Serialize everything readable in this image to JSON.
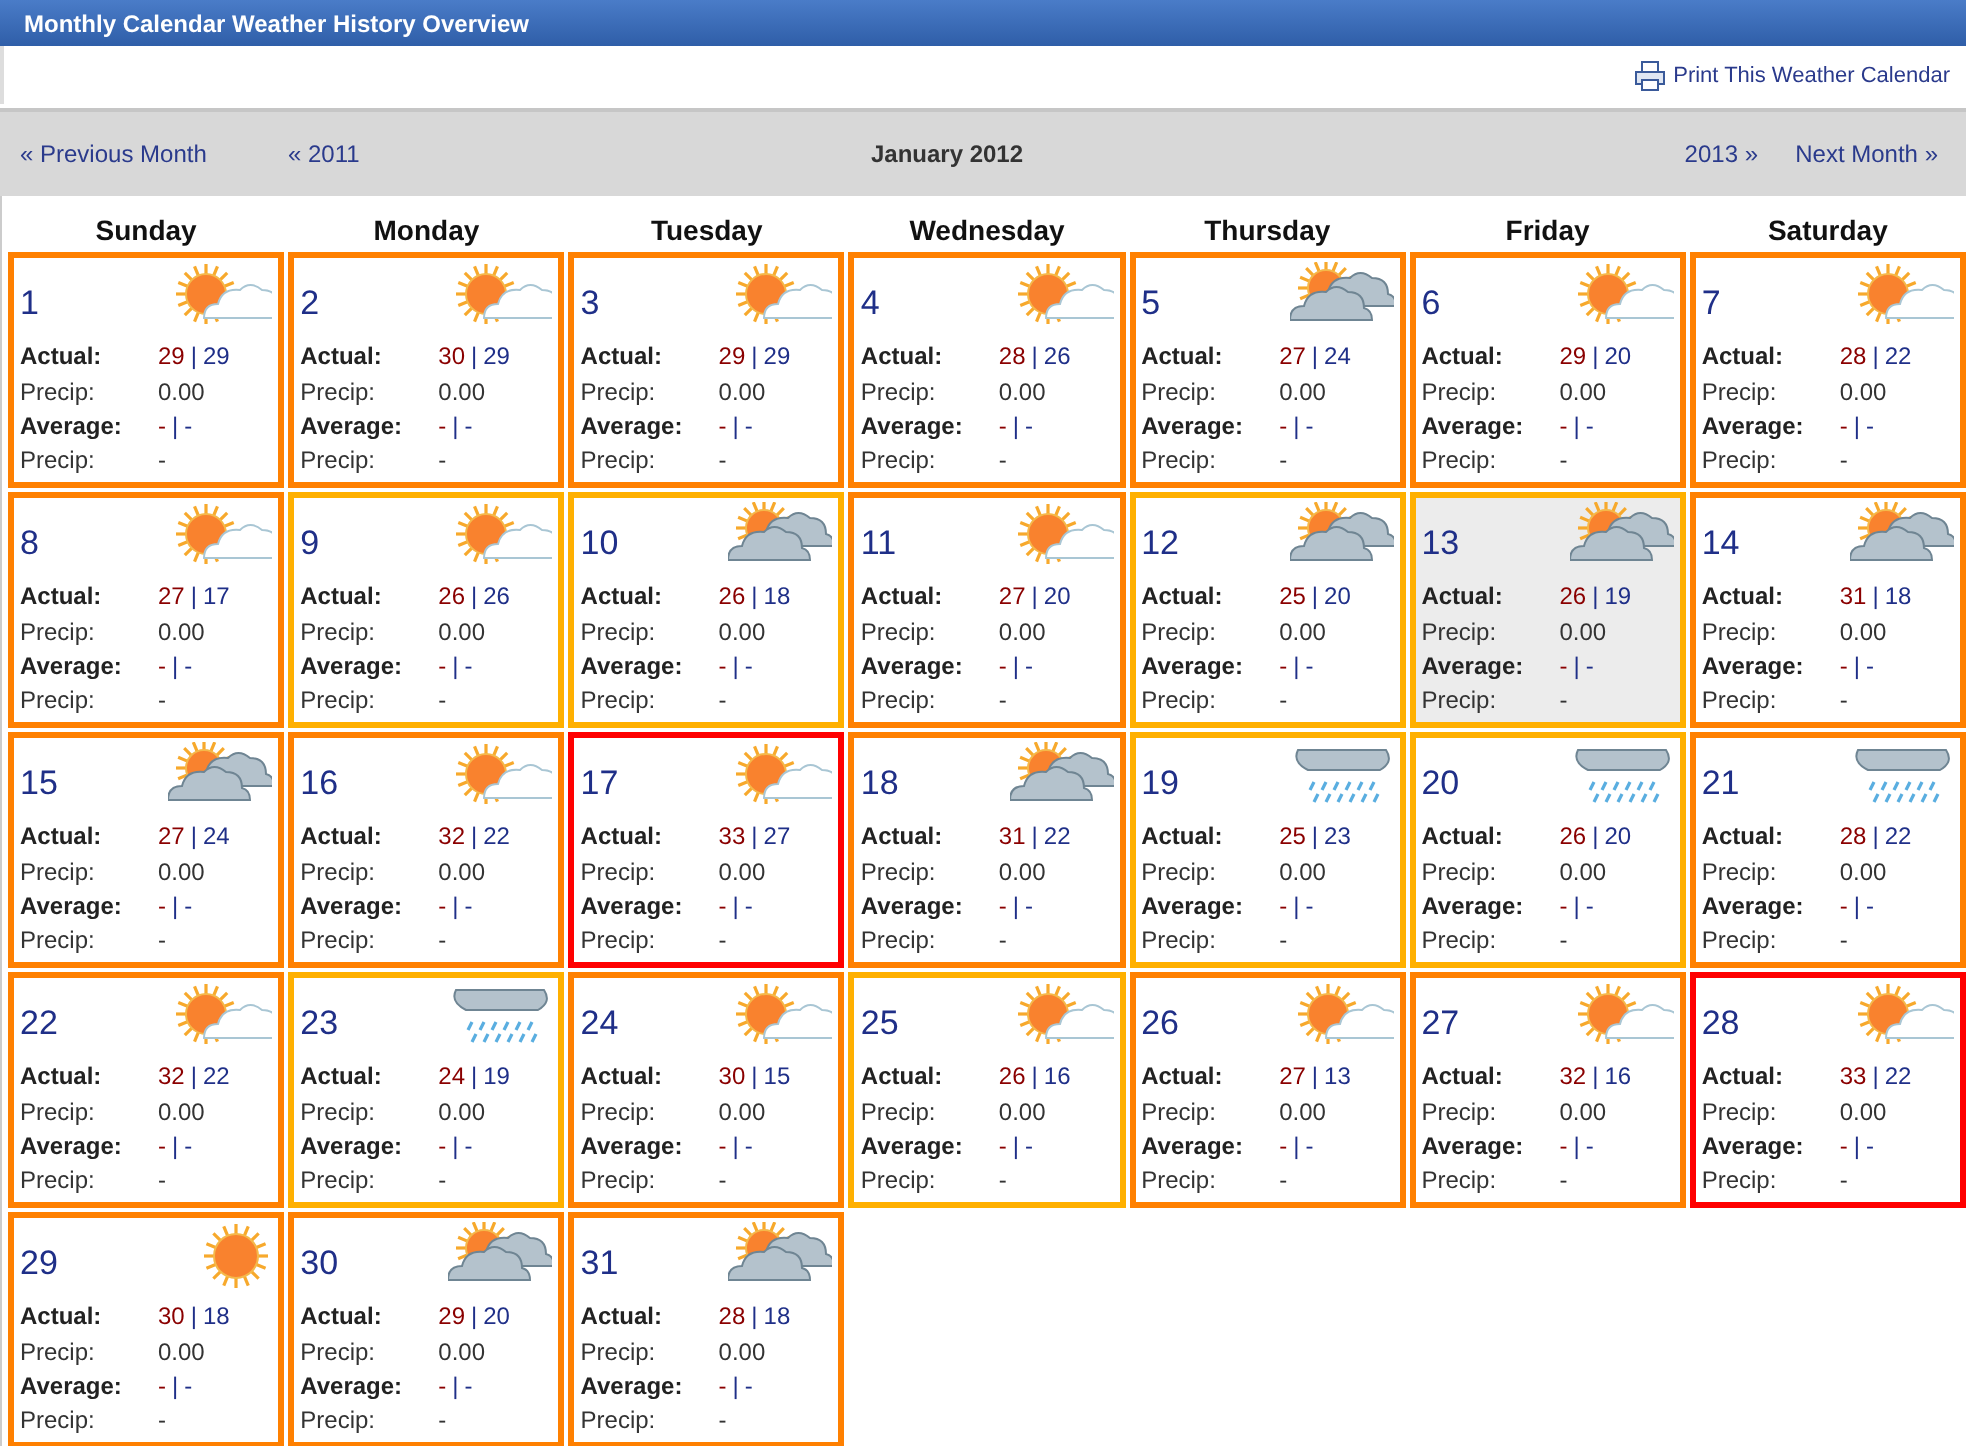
{
  "window": {
    "title": "Monthly Calendar Weather History Overview"
  },
  "print_link": "Print This Weather Calendar",
  "nav": {
    "prev_month": "« Previous Month",
    "prev_year": "« 2011",
    "current": "January 2012",
    "next_year": "2013 »",
    "next_month": "Next Month »"
  },
  "weekdays": [
    "Sunday",
    "Monday",
    "Tuesday",
    "Wednesday",
    "Thursday",
    "Friday",
    "Saturday"
  ],
  "days": [
    {
      "day": "1",
      "kind": "sun-cloud",
      "color": "#ff8000",
      "selected": false,
      "rows": [
        {
          "kind": "pair",
          "label": "Actual:",
          "high": "29",
          "sep": "|",
          "low": "29"
        },
        {
          "kind": "value",
          "label": "Precip:",
          "value": "0.00"
        },
        {
          "kind": "pair",
          "label": "Average:",
          "high": "-",
          "sep": "|",
          "low": "-"
        },
        {
          "kind": "value",
          "label": "Precip:",
          "value": "-"
        }
      ]
    },
    {
      "day": "2",
      "kind": "sun-cloud",
      "color": "#ff8000",
      "selected": false,
      "rows": [
        {
          "kind": "pair",
          "label": "Actual:",
          "high": "30",
          "sep": "|",
          "low": "29"
        },
        {
          "kind": "value",
          "label": "Precip:",
          "value": "0.00"
        },
        {
          "kind": "pair",
          "label": "Average:",
          "high": "-",
          "sep": "|",
          "low": "-"
        },
        {
          "kind": "value",
          "label": "Precip:",
          "value": "-"
        }
      ]
    },
    {
      "day": "3",
      "kind": "sun-cloud",
      "color": "#ff8000",
      "selected": false,
      "rows": [
        {
          "kind": "pair",
          "label": "Actual:",
          "high": "29",
          "sep": "|",
          "low": "29"
        },
        {
          "kind": "value",
          "label": "Precip:",
          "value": "0.00"
        },
        {
          "kind": "pair",
          "label": "Average:",
          "high": "-",
          "sep": "|",
          "low": "-"
        },
        {
          "kind": "value",
          "label": "Precip:",
          "value": "-"
        }
      ]
    },
    {
      "day": "4",
      "kind": "sun-cloud",
      "color": "#ff8000",
      "selected": false,
      "rows": [
        {
          "kind": "pair",
          "label": "Actual:",
          "high": "28",
          "sep": "|",
          "low": "26"
        },
        {
          "kind": "value",
          "label": "Precip:",
          "value": "0.00"
        },
        {
          "kind": "pair",
          "label": "Average:",
          "high": "-",
          "sep": "|",
          "low": "-"
        },
        {
          "kind": "value",
          "label": "Precip:",
          "value": "-"
        }
      ]
    },
    {
      "day": "5",
      "kind": "cloudy",
      "color": "#ff8000",
      "selected": false,
      "rows": [
        {
          "kind": "pair",
          "label": "Actual:",
          "high": "27",
          "sep": "|",
          "low": "24"
        },
        {
          "kind": "value",
          "label": "Precip:",
          "value": "0.00"
        },
        {
          "kind": "pair",
          "label": "Average:",
          "high": "-",
          "sep": "|",
          "low": "-"
        },
        {
          "kind": "value",
          "label": "Precip:",
          "value": "-"
        }
      ]
    },
    {
      "day": "6",
      "kind": "sun-cloud",
      "color": "#ff8000",
      "selected": false,
      "rows": [
        {
          "kind": "pair",
          "label": "Actual:",
          "high": "29",
          "sep": "|",
          "low": "20"
        },
        {
          "kind": "value",
          "label": "Precip:",
          "value": "0.00"
        },
        {
          "kind": "pair",
          "label": "Average:",
          "high": "-",
          "sep": "|",
          "low": "-"
        },
        {
          "kind": "value",
          "label": "Precip:",
          "value": "-"
        }
      ]
    },
    {
      "day": "7",
      "kind": "sun-cloud",
      "color": "#ff8000",
      "selected": false,
      "rows": [
        {
          "kind": "pair",
          "label": "Actual:",
          "high": "28",
          "sep": "|",
          "low": "22"
        },
        {
          "kind": "value",
          "label": "Precip:",
          "value": "0.00"
        },
        {
          "kind": "pair",
          "label": "Average:",
          "high": "-",
          "sep": "|",
          "low": "-"
        },
        {
          "kind": "value",
          "label": "Precip:",
          "value": "-"
        }
      ]
    },
    {
      "day": "8",
      "kind": "sun-cloud",
      "color": "#ff8000",
      "selected": false,
      "rows": [
        {
          "kind": "pair",
          "label": "Actual:",
          "high": "27",
          "sep": "|",
          "low": "17"
        },
        {
          "kind": "value",
          "label": "Precip:",
          "value": "0.00"
        },
        {
          "kind": "pair",
          "label": "Average:",
          "high": "-",
          "sep": "|",
          "low": "-"
        },
        {
          "kind": "value",
          "label": "Precip:",
          "value": "-"
        }
      ]
    },
    {
      "day": "9",
      "kind": "sun-cloud",
      "color": "#ffb000",
      "selected": false,
      "rows": [
        {
          "kind": "pair",
          "label": "Actual:",
          "high": "26",
          "sep": "|",
          "low": "26"
        },
        {
          "kind": "value",
          "label": "Precip:",
          "value": "0.00"
        },
        {
          "kind": "pair",
          "label": "Average:",
          "high": "-",
          "sep": "|",
          "low": "-"
        },
        {
          "kind": "value",
          "label": "Precip:",
          "value": "-"
        }
      ]
    },
    {
      "day": "10",
      "kind": "cloudy",
      "color": "#ffb000",
      "selected": false,
      "rows": [
        {
          "kind": "pair",
          "label": "Actual:",
          "high": "26",
          "sep": "|",
          "low": "18"
        },
        {
          "kind": "value",
          "label": "Precip:",
          "value": "0.00"
        },
        {
          "kind": "pair",
          "label": "Average:",
          "high": "-",
          "sep": "|",
          "low": "-"
        },
        {
          "kind": "value",
          "label": "Precip:",
          "value": "-"
        }
      ]
    },
    {
      "day": "11",
      "kind": "sun-cloud",
      "color": "#ff8000",
      "selected": false,
      "rows": [
        {
          "kind": "pair",
          "label": "Actual:",
          "high": "27",
          "sep": "|",
          "low": "20"
        },
        {
          "kind": "value",
          "label": "Precip:",
          "value": "0.00"
        },
        {
          "kind": "pair",
          "label": "Average:",
          "high": "-",
          "sep": "|",
          "low": "-"
        },
        {
          "kind": "value",
          "label": "Precip:",
          "value": "-"
        }
      ]
    },
    {
      "day": "12",
      "kind": "cloudy",
      "color": "#ffb000",
      "selected": false,
      "rows": [
        {
          "kind": "pair",
          "label": "Actual:",
          "high": "25",
          "sep": "|",
          "low": "20"
        },
        {
          "kind": "value",
          "label": "Precip:",
          "value": "0.00"
        },
        {
          "kind": "pair",
          "label": "Average:",
          "high": "-",
          "sep": "|",
          "low": "-"
        },
        {
          "kind": "value",
          "label": "Precip:",
          "value": "-"
        }
      ]
    },
    {
      "day": "13",
      "kind": "cloudy",
      "color": "#ffb000",
      "selected": true,
      "rows": [
        {
          "kind": "pair",
          "label": "Actual:",
          "high": "26",
          "sep": "|",
          "low": "19"
        },
        {
          "kind": "value",
          "label": "Precip:",
          "value": "0.00"
        },
        {
          "kind": "pair",
          "label": "Average:",
          "high": "-",
          "sep": "|",
          "low": "-"
        },
        {
          "kind": "value",
          "label": "Precip:",
          "value": "-"
        }
      ]
    },
    {
      "day": "14",
      "kind": "cloudy",
      "color": "#ff8000",
      "selected": false,
      "rows": [
        {
          "kind": "pair",
          "label": "Actual:",
          "high": "31",
          "sep": "|",
          "low": "18"
        },
        {
          "kind": "value",
          "label": "Precip:",
          "value": "0.00"
        },
        {
          "kind": "pair",
          "label": "Average:",
          "high": "-",
          "sep": "|",
          "low": "-"
        },
        {
          "kind": "value",
          "label": "Precip:",
          "value": "-"
        }
      ]
    },
    {
      "day": "15",
      "kind": "cloudy",
      "color": "#ff8000",
      "selected": false,
      "rows": [
        {
          "kind": "pair",
          "label": "Actual:",
          "high": "27",
          "sep": "|",
          "low": "24"
        },
        {
          "kind": "value",
          "label": "Precip:",
          "value": "0.00"
        },
        {
          "kind": "pair",
          "label": "Average:",
          "high": "-",
          "sep": "|",
          "low": "-"
        },
        {
          "kind": "value",
          "label": "Precip:",
          "value": "-"
        }
      ]
    },
    {
      "day": "16",
      "kind": "sun-cloud",
      "color": "#ff8000",
      "selected": false,
      "rows": [
        {
          "kind": "pair",
          "label": "Actual:",
          "high": "32",
          "sep": "|",
          "low": "22"
        },
        {
          "kind": "value",
          "label": "Precip:",
          "value": "0.00"
        },
        {
          "kind": "pair",
          "label": "Average:",
          "high": "-",
          "sep": "|",
          "low": "-"
        },
        {
          "kind": "value",
          "label": "Precip:",
          "value": "-"
        }
      ]
    },
    {
      "day": "17",
      "kind": "sun-cloud",
      "color": "#ff0000",
      "selected": false,
      "rows": [
        {
          "kind": "pair",
          "label": "Actual:",
          "high": "33",
          "sep": "|",
          "low": "27"
        },
        {
          "kind": "value",
          "label": "Precip:",
          "value": "0.00"
        },
        {
          "kind": "pair",
          "label": "Average:",
          "high": "-",
          "sep": "|",
          "low": "-"
        },
        {
          "kind": "value",
          "label": "Precip:",
          "value": "-"
        }
      ]
    },
    {
      "day": "18",
      "kind": "cloudy",
      "color": "#ff8000",
      "selected": false,
      "rows": [
        {
          "kind": "pair",
          "label": "Actual:",
          "high": "31",
          "sep": "|",
          "low": "22"
        },
        {
          "kind": "value",
          "label": "Precip:",
          "value": "0.00"
        },
        {
          "kind": "pair",
          "label": "Average:",
          "high": "-",
          "sep": "|",
          "low": "-"
        },
        {
          "kind": "value",
          "label": "Precip:",
          "value": "-"
        }
      ]
    },
    {
      "day": "19",
      "kind": "rain",
      "color": "#ffb000",
      "selected": false,
      "rows": [
        {
          "kind": "pair",
          "label": "Actual:",
          "high": "25",
          "sep": "|",
          "low": "23"
        },
        {
          "kind": "value",
          "label": "Precip:",
          "value": "0.00"
        },
        {
          "kind": "pair",
          "label": "Average:",
          "high": "-",
          "sep": "|",
          "low": "-"
        },
        {
          "kind": "value",
          "label": "Precip:",
          "value": "-"
        }
      ]
    },
    {
      "day": "20",
      "kind": "rain",
      "color": "#ffb000",
      "selected": false,
      "rows": [
        {
          "kind": "pair",
          "label": "Actual:",
          "high": "26",
          "sep": "|",
          "low": "20"
        },
        {
          "kind": "value",
          "label": "Precip:",
          "value": "0.00"
        },
        {
          "kind": "pair",
          "label": "Average:",
          "high": "-",
          "sep": "|",
          "low": "-"
        },
        {
          "kind": "value",
          "label": "Precip:",
          "value": "-"
        }
      ]
    },
    {
      "day": "21",
      "kind": "rain",
      "color": "#ff8000",
      "selected": false,
      "rows": [
        {
          "kind": "pair",
          "label": "Actual:",
          "high": "28",
          "sep": "|",
          "low": "22"
        },
        {
          "kind": "value",
          "label": "Precip:",
          "value": "0.00"
        },
        {
          "kind": "pair",
          "label": "Average:",
          "high": "-",
          "sep": "|",
          "low": "-"
        },
        {
          "kind": "value",
          "label": "Precip:",
          "value": "-"
        }
      ]
    },
    {
      "day": "22",
      "kind": "sun-cloud",
      "color": "#ff8000",
      "selected": false,
      "rows": [
        {
          "kind": "pair",
          "label": "Actual:",
          "high": "32",
          "sep": "|",
          "low": "22"
        },
        {
          "kind": "value",
          "label": "Precip:",
          "value": "0.00"
        },
        {
          "kind": "pair",
          "label": "Average:",
          "high": "-",
          "sep": "|",
          "low": "-"
        },
        {
          "kind": "value",
          "label": "Precip:",
          "value": "-"
        }
      ]
    },
    {
      "day": "23",
      "kind": "rain",
      "color": "#ffb000",
      "selected": false,
      "rows": [
        {
          "kind": "pair",
          "label": "Actual:",
          "high": "24",
          "sep": "|",
          "low": "19"
        },
        {
          "kind": "value",
          "label": "Precip:",
          "value": "0.00"
        },
        {
          "kind": "pair",
          "label": "Average:",
          "high": "-",
          "sep": "|",
          "low": "-"
        },
        {
          "kind": "value",
          "label": "Precip:",
          "value": "-"
        }
      ]
    },
    {
      "day": "24",
      "kind": "sun-cloud",
      "color": "#ff8000",
      "selected": false,
      "rows": [
        {
          "kind": "pair",
          "label": "Actual:",
          "high": "30",
          "sep": "|",
          "low": "15"
        },
        {
          "kind": "value",
          "label": "Precip:",
          "value": "0.00"
        },
        {
          "kind": "pair",
          "label": "Average:",
          "high": "-",
          "sep": "|",
          "low": "-"
        },
        {
          "kind": "value",
          "label": "Precip:",
          "value": "-"
        }
      ]
    },
    {
      "day": "25",
      "kind": "sun-cloud",
      "color": "#ffb000",
      "selected": false,
      "rows": [
        {
          "kind": "pair",
          "label": "Actual:",
          "high": "26",
          "sep": "|",
          "low": "16"
        },
        {
          "kind": "value",
          "label": "Precip:",
          "value": "0.00"
        },
        {
          "kind": "pair",
          "label": "Average:",
          "high": "-",
          "sep": "|",
          "low": "-"
        },
        {
          "kind": "value",
          "label": "Precip:",
          "value": "-"
        }
      ]
    },
    {
      "day": "26",
      "kind": "sun-cloud",
      "color": "#ff8000",
      "selected": false,
      "rows": [
        {
          "kind": "pair",
          "label": "Actual:",
          "high": "27",
          "sep": "|",
          "low": "13"
        },
        {
          "kind": "value",
          "label": "Precip:",
          "value": "0.00"
        },
        {
          "kind": "pair",
          "label": "Average:",
          "high": "-",
          "sep": "|",
          "low": "-"
        },
        {
          "kind": "value",
          "label": "Precip:",
          "value": "-"
        }
      ]
    },
    {
      "day": "27",
      "kind": "sun-cloud",
      "color": "#ff8000",
      "selected": false,
      "rows": [
        {
          "kind": "pair",
          "label": "Actual:",
          "high": "32",
          "sep": "|",
          "low": "16"
        },
        {
          "kind": "value",
          "label": "Precip:",
          "value": "0.00"
        },
        {
          "kind": "pair",
          "label": "Average:",
          "high": "-",
          "sep": "|",
          "low": "-"
        },
        {
          "kind": "value",
          "label": "Precip:",
          "value": "-"
        }
      ]
    },
    {
      "day": "28",
      "kind": "sun-cloud",
      "color": "#ff0000",
      "selected": false,
      "rows": [
        {
          "kind": "pair",
          "label": "Actual:",
          "high": "33",
          "sep": "|",
          "low": "22"
        },
        {
          "kind": "value",
          "label": "Precip:",
          "value": "0.00"
        },
        {
          "kind": "pair",
          "label": "Average:",
          "high": "-",
          "sep": "|",
          "low": "-"
        },
        {
          "kind": "value",
          "label": "Precip:",
          "value": "-"
        }
      ]
    },
    {
      "day": "29",
      "kind": "sun",
      "color": "#ff8000",
      "selected": false,
      "rows": [
        {
          "kind": "pair",
          "label": "Actual:",
          "high": "30",
          "sep": "|",
          "low": "18"
        },
        {
          "kind": "value",
          "label": "Precip:",
          "value": "0.00"
        },
        {
          "kind": "pair",
          "label": "Average:",
          "high": "-",
          "sep": "|",
          "low": "-"
        },
        {
          "kind": "value",
          "label": "Precip:",
          "value": "-"
        }
      ]
    },
    {
      "day": "30",
      "kind": "cloudy",
      "color": "#ff8000",
      "selected": false,
      "rows": [
        {
          "kind": "pair",
          "label": "Actual:",
          "high": "29",
          "sep": "|",
          "low": "20"
        },
        {
          "kind": "value",
          "label": "Precip:",
          "value": "0.00"
        },
        {
          "kind": "pair",
          "label": "Average:",
          "high": "-",
          "sep": "|",
          "low": "-"
        },
        {
          "kind": "value",
          "label": "Precip:",
          "value": "-"
        }
      ]
    },
    {
      "day": "31",
      "kind": "cloudy",
      "color": "#ff8000",
      "selected": false,
      "rows": [
        {
          "kind": "pair",
          "label": "Actual:",
          "high": "28",
          "sep": "|",
          "low": "18"
        },
        {
          "kind": "value",
          "label": "Precip:",
          "value": "0.00"
        },
        {
          "kind": "pair",
          "label": "Average:",
          "high": "-",
          "sep": "|",
          "low": "-"
        },
        {
          "kind": "value",
          "label": "Precip:",
          "value": "-"
        }
      ]
    }
  ]
}
